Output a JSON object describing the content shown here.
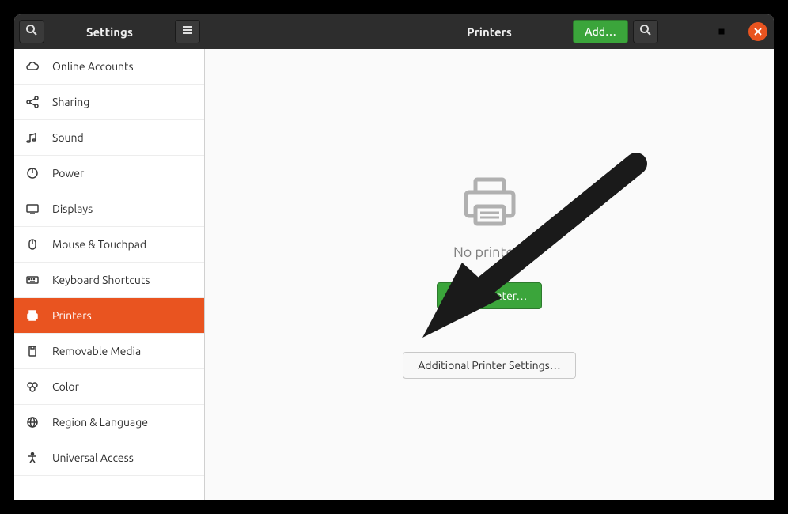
{
  "titlebar": {
    "side_title": "Settings",
    "main_title": "Printers",
    "add_button": "Add…"
  },
  "sidebar": {
    "items": [
      {
        "label": "Online Accounts",
        "icon": "cloud-icon",
        "active": false
      },
      {
        "label": "Sharing",
        "icon": "share-icon",
        "active": false
      },
      {
        "label": "Sound",
        "icon": "sound-icon",
        "active": false
      },
      {
        "label": "Power",
        "icon": "power-icon",
        "active": false
      },
      {
        "label": "Displays",
        "icon": "display-icon",
        "active": false
      },
      {
        "label": "Mouse & Touchpad",
        "icon": "mouse-icon",
        "active": false
      },
      {
        "label": "Keyboard Shortcuts",
        "icon": "keyboard-icon",
        "active": false
      },
      {
        "label": "Printers",
        "icon": "printer-icon",
        "active": true
      },
      {
        "label": "Removable Media",
        "icon": "removable-icon",
        "active": false
      },
      {
        "label": "Color",
        "icon": "color-icon",
        "active": false
      },
      {
        "label": "Region & Language",
        "icon": "globe-icon",
        "active": false
      },
      {
        "label": "Universal Access",
        "icon": "accessibility-icon",
        "active": false
      }
    ]
  },
  "main": {
    "empty_text": "No printers",
    "add_printer": "Add a Printer…",
    "additional_settings": "Additional Printer Settings…"
  },
  "colors": {
    "accent": "#e95420",
    "success": "#3ba53b"
  }
}
